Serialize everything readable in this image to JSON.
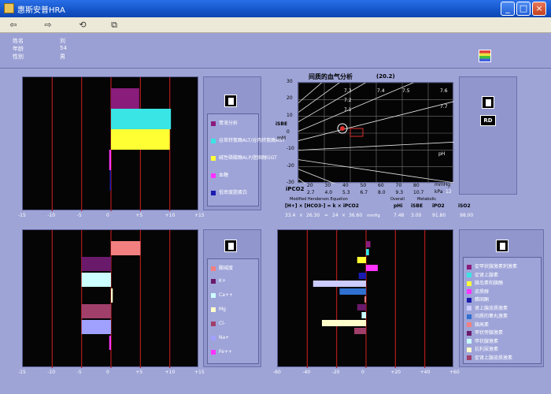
{
  "window": {
    "title": "惠斯安普HRA"
  },
  "toolbar": {
    "icons": [
      "arrow-left-icon",
      "arrow-right-icon",
      "refresh-icon",
      "copy-icon"
    ]
  },
  "patient": {
    "name_label": "姓名",
    "name_value": "刘",
    "age_label": "年龄",
    "age_value": "54",
    "sex_label": "性别",
    "sex_value": "男"
  },
  "colors": {
    "red_line": "#b21b1b",
    "grid_line": "#777777",
    "panel_bg": "#000000"
  },
  "top_left_chart": {
    "x_ticks": [
      "-15",
      "-10",
      "-5",
      "0",
      "+5",
      "+10",
      "+15"
    ],
    "legend": [
      {
        "label": "胃液分析",
        "color": "#8a1c7c"
      },
      {
        "label": "谷草转氨酶ALT/谷丙转氨酶AST",
        "color": "#39e5e5"
      },
      {
        "label": "碱性磷酸酶ALP/胆固醇GGT",
        "color": "#ffff33"
      },
      {
        "label": "血糖",
        "color": "#ff33ff"
      },
      {
        "label": "低密度脂蛋白",
        "color": "#1b1bb0"
      }
    ],
    "chart_data": {
      "type": "bar",
      "orientation": "horizontal",
      "xlim": [
        -15,
        15
      ],
      "bars": [
        {
          "name": "胃液分析",
          "value": 4.8,
          "color": "#8a1c7c"
        },
        {
          "name": "谷草转氨酶ALT/谷丙转氨酶AST",
          "value": 10.2,
          "color": "#39e5e5"
        },
        {
          "name": "碱性磷酸酶ALP/胆固醇GGT",
          "value": 10.0,
          "color": "#ffff33"
        },
        {
          "name": "血糖",
          "value": -0.3,
          "color": "#ff33ff"
        },
        {
          "name": "低密度脂蛋白",
          "value": -0.2,
          "color": "#1b1bb0"
        }
      ]
    }
  },
  "blood_gas": {
    "title": "间质的血气分析",
    "title_value": "(20.2)",
    "y_label_top": "iSBE",
    "y_label_unit": "mM",
    "x_label": "iPCO2",
    "x_unit_1": "mmHg",
    "x_unit_2": "kPa",
    "y_ticks": [
      "30",
      "20",
      "10",
      "0",
      "-10",
      "-20",
      "-30"
    ],
    "x_ticks_mmhg": [
      "20",
      "30",
      "40",
      "50",
      "60",
      "70",
      "80"
    ],
    "x_ticks_kpa": [
      "2.7",
      "4.0",
      "5.3",
      "6.7",
      "8.0",
      "9.3",
      "10.7"
    ],
    "x_extra_kpa": "12",
    "ph_labels": [
      "7.3",
      "7.2",
      "7.1",
      "7.4",
      "7.5",
      "7.6",
      "7.7"
    ],
    "ph_label": "pH",
    "equation_title": "Modified Henderson Equation",
    "overall_label": "Overall",
    "metabolic_label": "Metabolic",
    "equation": "[H+] × [HCO3-] = k × iPCO2",
    "values_row": {
      "h": "33.4",
      "hco3": "26.30",
      "k": "24",
      "pco2": "36.60",
      "unit": "mmHg",
      "ph": "7.48",
      "isbe": "3.00",
      "ipo2": "91.80",
      "iso2": "98.00"
    },
    "headers": {
      "phi": "pHi",
      "isbe": "iSBE",
      "ipo2": "iPO2",
      "iso2": "iSO2"
    },
    "rd_label": "RD"
  },
  "bottom_left_chart": {
    "x_ticks": [
      "-15",
      "-10",
      "-5",
      "0",
      "+5",
      "+10",
      "+15"
    ],
    "legend": [
      {
        "label": "酸碱度",
        "color": "#f28080"
      },
      {
        "label": "K+",
        "color": "#6a1a6a"
      },
      {
        "label": "Ca++",
        "color": "#ccffff"
      },
      {
        "label": "Mg",
        "color": "#ffffcc"
      },
      {
        "label": "Cl-",
        "color": "#a0406a"
      },
      {
        "label": "Na+",
        "color": "#a0a0ff"
      },
      {
        "label": "Fe++",
        "color": "#ff33ff"
      }
    ],
    "chart_data": {
      "type": "bar",
      "orientation": "horizontal",
      "xlim": [
        -15,
        15
      ],
      "bars": [
        {
          "name": "酸碱度",
          "value": 5.0,
          "color": "#f28080"
        },
        {
          "name": "K+",
          "value": -5.0,
          "color": "#6a1a6a"
        },
        {
          "name": "Ca++",
          "value": -5.0,
          "color": "#ccffff"
        },
        {
          "name": "Mg",
          "value": 0.3,
          "color": "#ffffcc"
        },
        {
          "name": "Cl-",
          "value": -5.0,
          "color": "#a0406a"
        },
        {
          "name": "Na+",
          "value": -5.0,
          "color": "#a0a0ff"
        },
        {
          "name": "Fe++",
          "value": -0.3,
          "color": "#ff33ff"
        }
      ]
    }
  },
  "bottom_right_chart": {
    "x_ticks": [
      "-60",
      "-40",
      "-20",
      "0",
      "+20",
      "+40",
      "+60"
    ],
    "legend": [
      {
        "label": "促甲状腺激素刺激素",
        "color": "#8a1c7c"
      },
      {
        "label": "促肾上腺素",
        "color": "#39e5e5"
      },
      {
        "label": "胰岛素和胰酶",
        "color": "#ffff33"
      },
      {
        "label": "皮质醇",
        "color": "#ff33ff"
      },
      {
        "label": "醛固酮",
        "color": "#1b1bb0"
      },
      {
        "label": "肾上腺皮质激素",
        "color": "#ccccff"
      },
      {
        "label": "间质的睾丸激素",
        "color": "#3070d0"
      },
      {
        "label": "胰高素",
        "color": "#f28080"
      },
      {
        "label": "甲状旁腺激素",
        "color": "#6a1a6a"
      },
      {
        "label": "甲状腺激素",
        "color": "#ccffff"
      },
      {
        "label": "抗利尿激素",
        "color": "#ffffcc"
      },
      {
        "label": "促肾上腺皮质激素",
        "color": "#a0406a"
      }
    ],
    "chart_data": {
      "type": "bar",
      "orientation": "horizontal",
      "xlim": [
        -60,
        60
      ],
      "bars": [
        {
          "name": "促甲状腺激素刺激素",
          "value": 3,
          "color": "#8a1c7c"
        },
        {
          "name": "促肾上腺素",
          "value": 2,
          "color": "#39e5e5"
        },
        {
          "name": "胰岛素和胰酶",
          "value": -6,
          "color": "#ffff33"
        },
        {
          "name": "皮质醇",
          "value": 8,
          "color": "#ff33ff"
        },
        {
          "name": "醛固酮",
          "value": -5,
          "color": "#1b1bb0"
        },
        {
          "name": "肾上腺皮质激素",
          "value": -36,
          "color": "#ccccff"
        },
        {
          "name": "间质的睾丸激素",
          "value": -18,
          "color": "#3070d0"
        },
        {
          "name": "胰高素",
          "value": -1,
          "color": "#f28080"
        },
        {
          "name": "甲状旁腺激素",
          "value": -6,
          "color": "#6a1a6a"
        },
        {
          "name": "甲状腺激素",
          "value": -3,
          "color": "#ccffff"
        },
        {
          "name": "抗利尿激素",
          "value": -30,
          "color": "#ffffcc"
        },
        {
          "name": "促肾上腺皮质激素",
          "value": -8,
          "color": "#a0406a"
        }
      ]
    }
  }
}
